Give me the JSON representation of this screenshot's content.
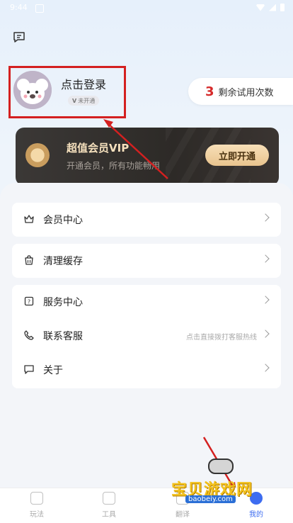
{
  "status": {
    "time": "9:44"
  },
  "profile": {
    "login_text": "点击登录",
    "badge": "未开通",
    "badge_mark": "V"
  },
  "trial": {
    "count": "3",
    "label": "剩余试用次数"
  },
  "vip": {
    "title": "超值会员VIP",
    "subtitle": "开通会员，所有功能畅用",
    "button": "立即开通"
  },
  "menu": {
    "member_center": "会员中心",
    "clear_cache": "清理缓存",
    "service_center": "服务中心",
    "contact": "联系客服",
    "contact_hint": "点击直接拨打客服热线",
    "about": "关于"
  },
  "nav": [
    {
      "label": "玩法"
    },
    {
      "label": "工具"
    },
    {
      "label": "翻译"
    },
    {
      "label": "我的"
    }
  ],
  "watermark": {
    "text": "宝贝游戏网",
    "url": "baobeiy.com"
  },
  "colors": {
    "accent": "#3d6cf0",
    "highlight_red": "#d42020",
    "trial_red": "#d62a2a",
    "vip_gold": "#e9c48e"
  }
}
